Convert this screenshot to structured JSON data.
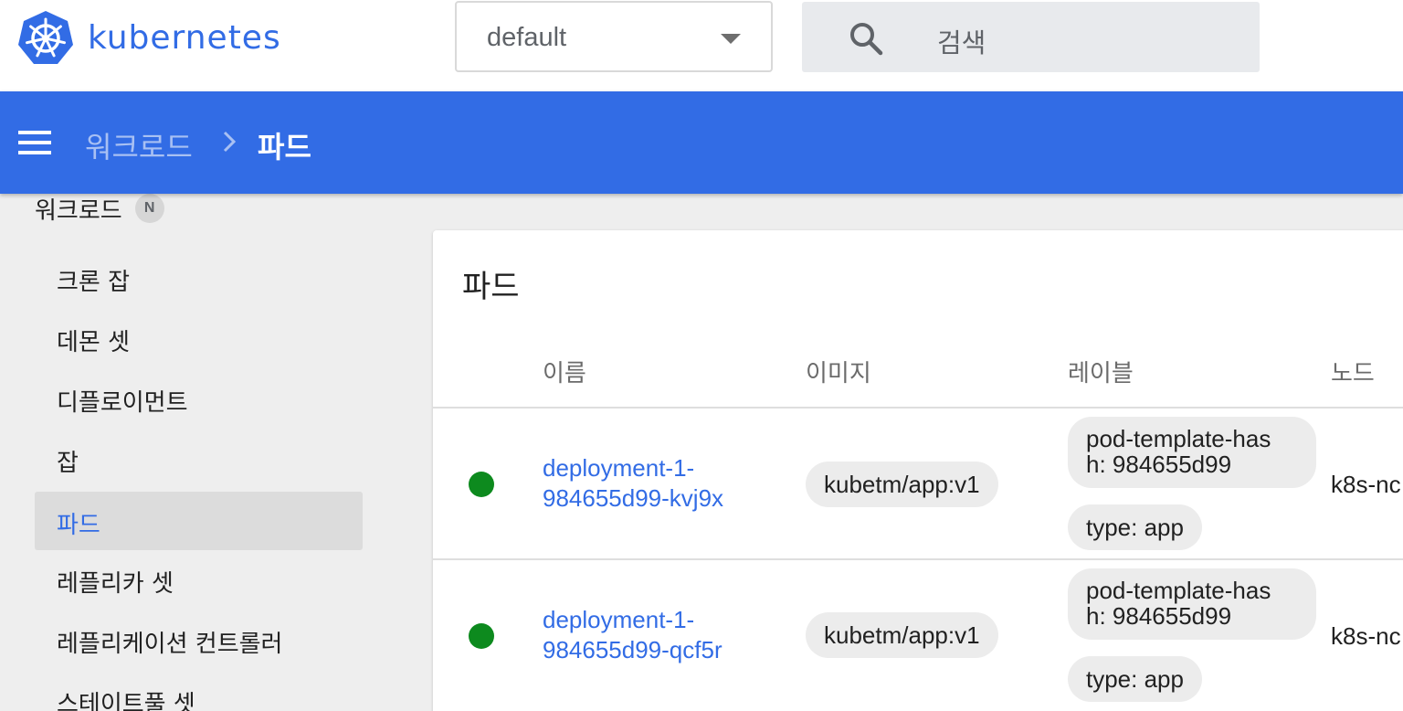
{
  "colors": {
    "accent": "#326ce5",
    "status_running": "#0d8a1e"
  },
  "header": {
    "brand": "kubernetes",
    "namespace_value": "default",
    "search_placeholder": "검색"
  },
  "breadcrumb": {
    "parent": "워크로드",
    "current": "파드"
  },
  "sidebar": {
    "section_label": "워크로드",
    "section_badge": "N",
    "items": [
      {
        "label": "크론 잡"
      },
      {
        "label": "데몬 셋"
      },
      {
        "label": "디플로이먼트"
      },
      {
        "label": "잡"
      },
      {
        "label": "파드",
        "active": true
      },
      {
        "label": "레플리카 셋"
      },
      {
        "label": "레플리케이션 컨트롤러"
      },
      {
        "label": "스테이트풀 셋"
      }
    ]
  },
  "pods": {
    "title": "파드",
    "columns": [
      "이름",
      "이미지",
      "레이블",
      "노드"
    ],
    "rows": [
      {
        "status": "running",
        "name_line1": "deployment-1-",
        "name_line2": "984655d99-kvj9x",
        "image": "kubetm/app:v1",
        "label1_line1": "pod-template-has",
        "label1_line2": "h: 984655d99",
        "label2": "type: app",
        "node": "k8s-nc"
      },
      {
        "status": "running",
        "name_line1": "deployment-1-",
        "name_line2": "984655d99-qcf5r",
        "image": "kubetm/app:v1",
        "label1_line1": "pod-template-has",
        "label1_line2": "h: 984655d99",
        "label2": "type: app",
        "node": "k8s-nc"
      }
    ]
  }
}
